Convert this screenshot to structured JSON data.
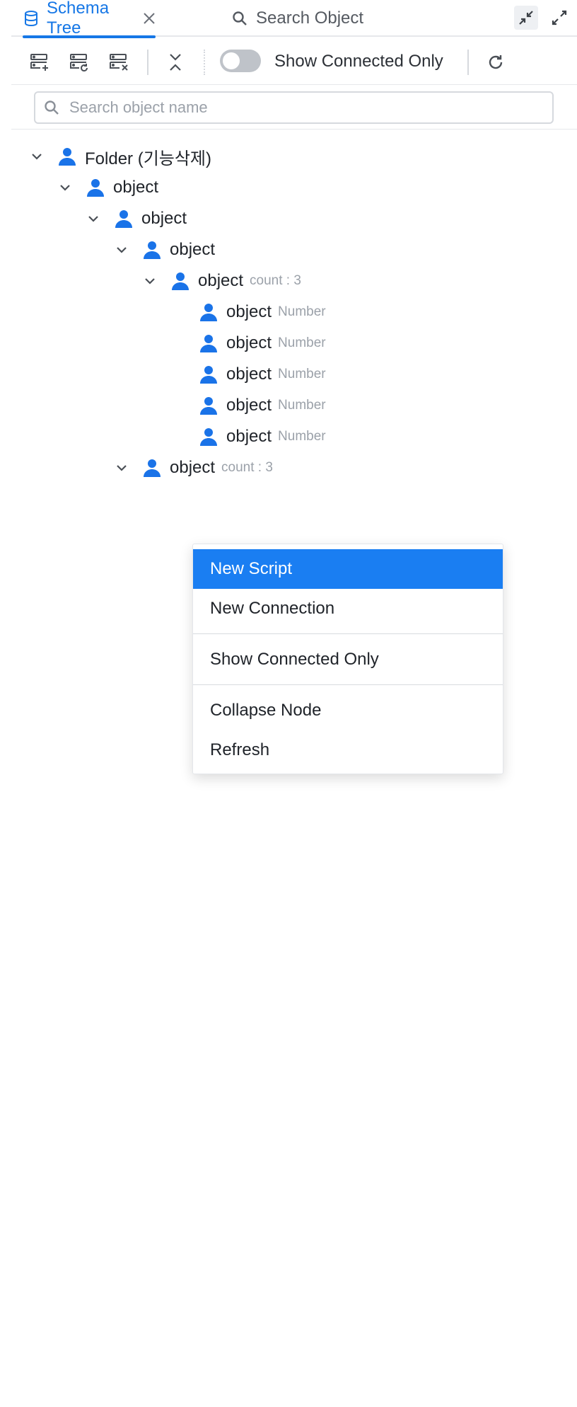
{
  "tabs": {
    "schema_tree": "Schema Tree",
    "search_object": "Search Object"
  },
  "toolbar": {
    "show_connected_only": "Show Connected Only"
  },
  "search": {
    "placeholder": "Search object name"
  },
  "tree": {
    "folder": {
      "label": "Folder (기능삭제)"
    },
    "level1": {
      "label": "object"
    },
    "level2": {
      "label": "object"
    },
    "level3": {
      "label": "object"
    },
    "level4": {
      "label": "object",
      "meta": "count : 3"
    },
    "leaves": [
      {
        "label": "object",
        "meta": "Number"
      },
      {
        "label": "object",
        "meta": "Number"
      },
      {
        "label": "object",
        "meta": "Number"
      },
      {
        "label": "object",
        "meta": "Number"
      },
      {
        "label": "object",
        "meta": "Number"
      }
    ],
    "sibling": {
      "label": "object",
      "meta": "count : 3"
    }
  },
  "context_menu": {
    "items": [
      {
        "label": "New Script"
      },
      {
        "label": "New Connection"
      },
      {
        "label": "Show Connected Only"
      },
      {
        "label": "Collapse Node"
      },
      {
        "label": "Refresh"
      }
    ]
  },
  "colors": {
    "accent": "#1677e6",
    "menu_highlight": "#1a7ef2",
    "icon_blue": "#1a73e8",
    "muted_text": "#9ba1a9",
    "toggle_off": "#bfc3c9"
  },
  "icons": {
    "schema_tab": "database-icon",
    "search_tab": "search-icon",
    "tree_node": "person-icon",
    "collapse_panel": "collapse-arrows-icon",
    "expand_panel": "expand-arrows-icon",
    "refresh": "refresh-icon"
  }
}
